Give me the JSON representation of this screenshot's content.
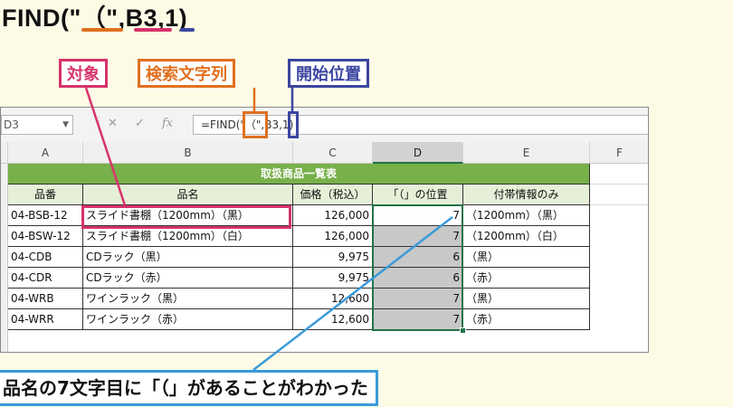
{
  "header_formula": "FIND(\"（\",B3,1)",
  "labels": {
    "target": "対象",
    "search_string": "検索文字列",
    "start_position": "開始位置"
  },
  "label_colors": {
    "target": "#d6336c",
    "search_string": "#e07020",
    "start_position": "#3b46a0"
  },
  "excel": {
    "name_box": "D3",
    "formula_bar": "=FIND(\"（\",B3,1)",
    "icons": [
      "cancel-icon",
      "enter-icon",
      "fx-icon"
    ],
    "columns": [
      "A",
      "B",
      "C",
      "D",
      "E",
      "F"
    ],
    "selected_column": "D",
    "table_title": "取扱商品一覧表",
    "table_headers": [
      "品番",
      "品名",
      "価格（税込）",
      "「（」の位置",
      "付帯情報のみ"
    ],
    "rows": [
      [
        "04-BSB-12",
        "スライド書棚（1200mm）（黒）",
        "126,000",
        "7",
        "（1200mm）（黒）"
      ],
      [
        "04-BSW-12",
        "スライド書棚（1200mm）（白）",
        "126,000",
        "7",
        "（1200mm）（白）"
      ],
      [
        "04-CDB",
        "CDラック（黒）",
        "9,975",
        "6",
        "（黒）"
      ],
      [
        "04-CDR",
        "CDラック（赤）",
        "9,975",
        "6",
        "（赤）"
      ],
      [
        "04-WRB",
        "ワインラック（黒）",
        "12,600",
        "7",
        "（黒）"
      ],
      [
        "04-WRR",
        "ワインラック（赤）",
        "12,600",
        "7",
        "（赤）"
      ]
    ]
  },
  "callout": "品名の7文字目に「（」があることがわかった",
  "colors": {
    "title_bar": "#78b04a",
    "header_row": "#e6f0d8",
    "selected_cells": "#c8c8c8",
    "callout_border": "#3a9ad9"
  }
}
